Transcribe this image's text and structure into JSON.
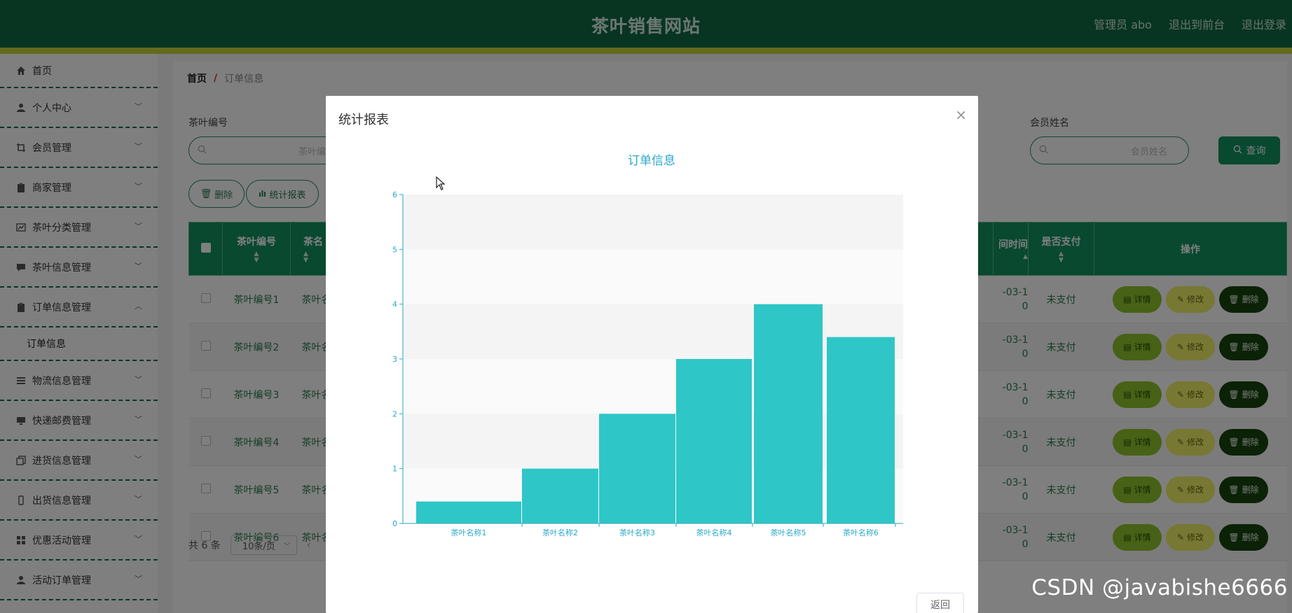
{
  "header": {
    "title": "茶叶销售网站",
    "admin": "管理员 abo",
    "to_front": "退出到前台",
    "logout": "退出登录",
    "bg_color": "#0e6b44",
    "stripe_color": "#c9d43a"
  },
  "sidebar": {
    "items": [
      {
        "label": "首页",
        "icon": "home-icon",
        "chevron": false
      },
      {
        "label": "个人中心",
        "icon": "user-icon",
        "chevron": true
      },
      {
        "label": "会员管理",
        "icon": "crop-icon",
        "chevron": true
      },
      {
        "label": "商家管理",
        "icon": "clipboard-icon",
        "chevron": true
      },
      {
        "label": "茶叶分类管理",
        "icon": "chart-icon",
        "chevron": true
      },
      {
        "label": "茶叶信息管理",
        "icon": "comment-icon",
        "chevron": true
      },
      {
        "label": "订单信息管理",
        "icon": "clipboard-icon",
        "chevron": true,
        "expanded": true
      },
      {
        "label": "订单信息",
        "sub": true
      },
      {
        "label": "物流信息管理",
        "icon": "menu-icon",
        "chevron": true
      },
      {
        "label": "快递邮费管理",
        "icon": "monitor-icon",
        "chevron": true
      },
      {
        "label": "进货信息管理",
        "icon": "copy-icon",
        "chevron": true
      },
      {
        "label": "出货信息管理",
        "icon": "phone-icon",
        "chevron": true
      },
      {
        "label": "优惠活动管理",
        "icon": "grid-icon",
        "chevron": true
      },
      {
        "label": "活动订单管理",
        "icon": "user-icon",
        "chevron": true
      }
    ]
  },
  "breadcrumb": {
    "home": "首页",
    "sep": "/",
    "current": "订单信息"
  },
  "filters": {
    "tea_no_label": "茶叶编号",
    "tea_no_placeholder": "茶叶编号",
    "member_name_label": "会员姓名",
    "member_name_placeholder": "会员姓名",
    "query_button": "查询"
  },
  "actions": {
    "delete": "删除",
    "report": "统计报表"
  },
  "table": {
    "headers": {
      "tea_no": "茶叶编号",
      "tea_name": "茶名",
      "time": "间时间",
      "paid": "是否支付",
      "ops": "操作"
    },
    "rows": [
      {
        "tea_no": "茶叶编号1",
        "tea_name": "茶叶名",
        "date_a": "-03-1",
        "date_b": "0",
        "paid": "未支付"
      },
      {
        "tea_no": "茶叶编号2",
        "tea_name": "茶叶名",
        "date_a": "-03-1",
        "date_b": "0",
        "paid": "未支付"
      },
      {
        "tea_no": "茶叶编号3",
        "tea_name": "茶叶名",
        "date_a": "-03-1",
        "date_b": "0",
        "paid": "未支付"
      },
      {
        "tea_no": "茶叶编号4",
        "tea_name": "茶叶名",
        "date_a": "-03-1",
        "date_b": "0",
        "paid": "未支付"
      },
      {
        "tea_no": "茶叶编号5",
        "tea_name": "茶叶名",
        "date_a": "-03-1",
        "date_b": "0",
        "paid": "未支付"
      },
      {
        "tea_no": "茶叶编号6",
        "tea_name": "茶叶名",
        "date_a": "-03-1",
        "date_b": "0",
        "paid": "未支付"
      }
    ],
    "op_detail": "详情",
    "op_edit": "修改",
    "op_delete": "删除"
  },
  "pager": {
    "total": "共 6 条",
    "page_size": "10条/页"
  },
  "dialog": {
    "title": "统计报表",
    "back_button": "返回",
    "close": "×"
  },
  "chart_data": {
    "type": "bar",
    "title": "订单信息",
    "categories": [
      "茶叶名称1",
      "茶叶名称2",
      "茶叶名称3",
      "茶叶名称4",
      "茶叶名称5",
      "茶叶名称6"
    ],
    "values": [
      0.4,
      1,
      2,
      3,
      4,
      3.4
    ],
    "ylim": [
      0,
      6
    ],
    "yticks": [
      0,
      1,
      2,
      3,
      4,
      5,
      6
    ],
    "color": "#2ec6c6",
    "axis_color": "#2aa8c8",
    "grid": true
  },
  "watermark": "CSDN @javabishe6666"
}
